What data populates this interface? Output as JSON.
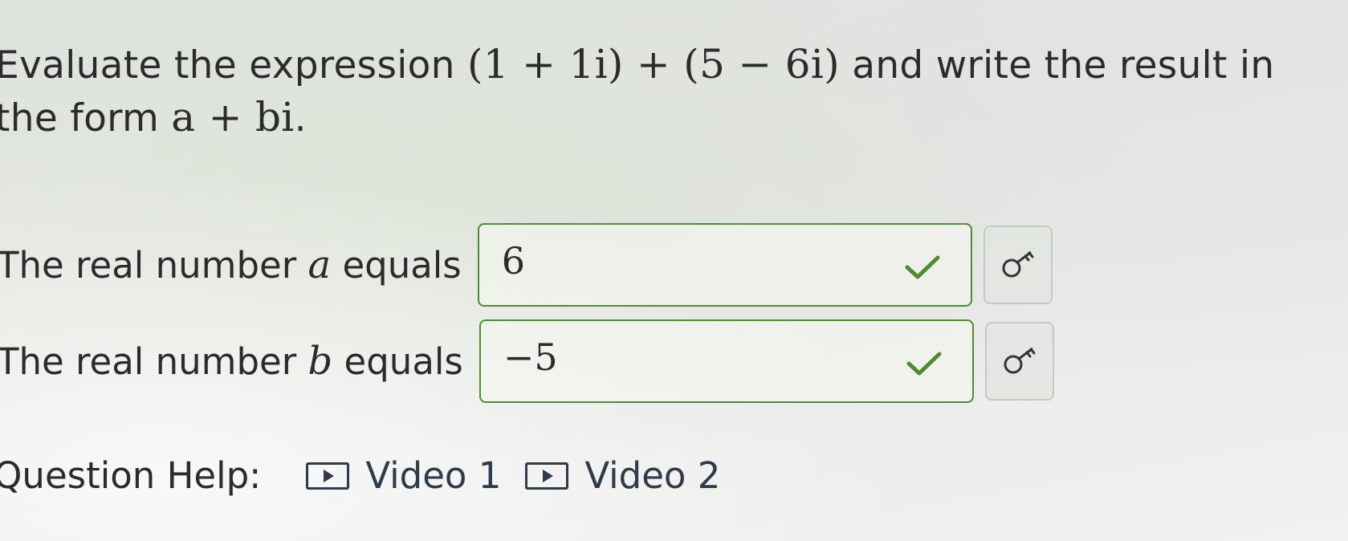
{
  "question": {
    "text_before": "Evaluate the expression ",
    "expression": "(1 + 1i) + (5 − 6i)",
    "text_middle": " and write the result in the form ",
    "form": "a + bi",
    "text_after": "."
  },
  "answers": [
    {
      "label_before": "The real number ",
      "variable": "a",
      "label_after": " equals",
      "value": "6",
      "status": "correct"
    },
    {
      "label_before": "The real number ",
      "variable": "b",
      "label_after": " equals",
      "value": "−5",
      "status": "correct"
    }
  ],
  "help": {
    "label": "Question Help:",
    "links": [
      {
        "label": "Video 1",
        "icon": "play-icon"
      },
      {
        "label": "Video 2",
        "icon": "play-icon"
      }
    ]
  },
  "colors": {
    "correct_border": "#4f8c31",
    "check": "#4f8c31"
  }
}
